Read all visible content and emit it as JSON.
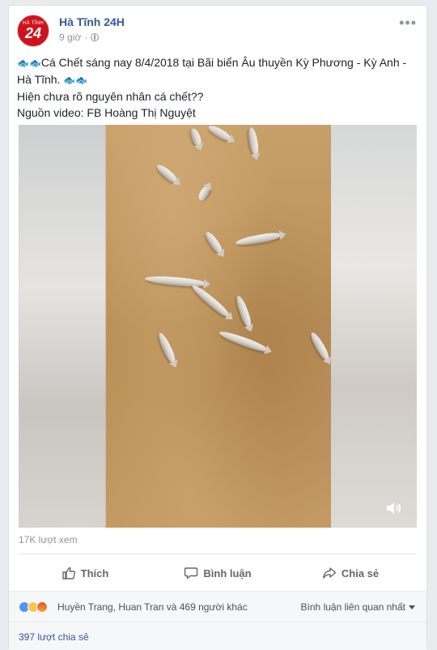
{
  "post": {
    "page_name": "Hà Tĩnh 24H",
    "avatar_small_text": "HÀ TĨNH",
    "avatar_big_text": "24",
    "time": "9 giờ",
    "text_line1_icons": "🐟🐟",
    "text_line1": "Cá Chết sáng nay 8/4/2018 tại Bãi biển Âu thuyền Kỳ Phương - Kỳ Anh - Hà Tĩnh.",
    "text_line1_tail_icons": "🐟🐟",
    "text_line2": "Hiện chưa rõ nguyên nhân cá chết??",
    "text_line3": "Nguồn video: FB Hoàng Thị Nguyệt"
  },
  "video": {
    "views": "17K lượt xem",
    "icon": "speaker-icon"
  },
  "actions": {
    "like": "Thích",
    "comment": "Bình luận",
    "share": "Chia sẻ"
  },
  "reactions": {
    "icons": [
      "like-icon",
      "sad-icon",
      "angry-icon"
    ],
    "names": "Huyền Trang, Huan Tran và 469 người khác",
    "sort_label": "Bình luận liên quan nhất"
  },
  "shares": {
    "count_label": "397 lượt chia sẻ"
  },
  "colors": {
    "link": "#365899",
    "muted": "#90949c",
    "background": "#e9ebee"
  }
}
